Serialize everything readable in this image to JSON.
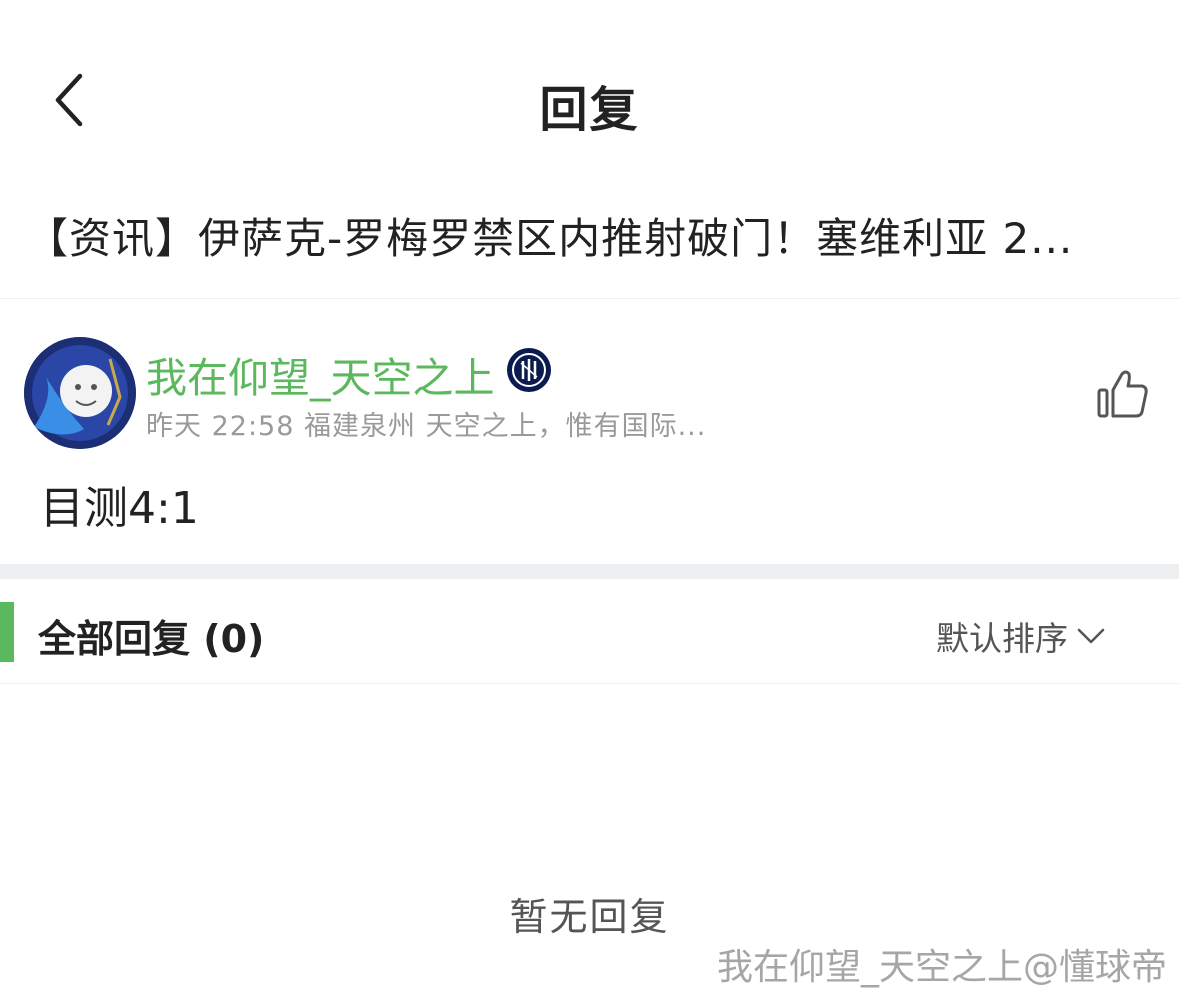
{
  "nav": {
    "title": "回复",
    "back_icon": "chevron-left-icon"
  },
  "article": {
    "title": "【资讯】伊萨克-罗梅罗禁区内推射破门！塞维利亚 2..."
  },
  "comment": {
    "username": "我在仰望_天空之上",
    "time": "昨天 22:58",
    "location": "福建泉州",
    "signature": "天空之上，惟有国际...",
    "text": "目测4:1",
    "like_icon": "thumbs-up-icon",
    "badge_icon": "inter-logo-icon"
  },
  "replies": {
    "title": "全部回复 (0)",
    "sort_label": "默认排序",
    "empty_text": "暂无回复"
  },
  "watermark": "我在仰望_天空之上@懂球帝",
  "colors": {
    "accent_green": "#5cb85c",
    "divider": "#eeeff1",
    "text": "#222222",
    "meta": "#9a9a9a"
  }
}
